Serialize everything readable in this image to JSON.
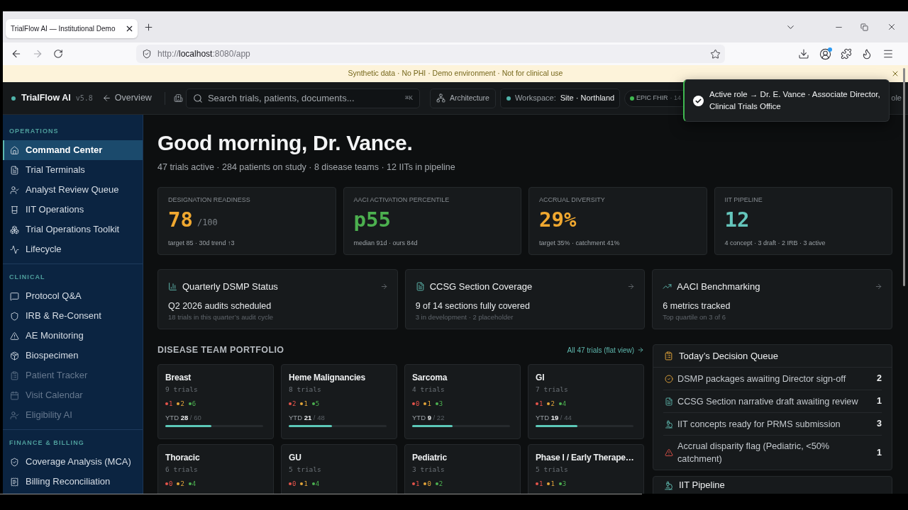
{
  "browser": {
    "tab_title": "TrialFlow AI — Institutional Demo",
    "url": {
      "scheme": "http://",
      "host": "localhost",
      "rest": ":8080/app"
    }
  },
  "banner": {
    "text": "Synthetic data · No PHI · Demo environment · Not for clinical use"
  },
  "header": {
    "brand": "TrialFlow AI",
    "version": "v5.8",
    "back_link": "Overview",
    "search": {
      "placeholder": "Search trials, patients, documents...",
      "shortcut": "⌘K"
    },
    "architecture": "Architecture",
    "workspace": {
      "label": "Workspace:",
      "value": "Site · Northland"
    },
    "integration": {
      "name": "EPIC FHIR",
      "detail": "· 14"
    },
    "role_fragment": "ole"
  },
  "toast": {
    "text": "Active role → Dr. E. Vance · Associate Director, Clinical Trials Office"
  },
  "sidebar": {
    "sections": [
      {
        "title": "OPERATIONS",
        "items": [
          {
            "label": "Command Center",
            "selected": true,
            "disabled": false
          },
          {
            "label": "Trial Terminals",
            "selected": false,
            "disabled": false
          },
          {
            "label": "Analyst Review Queue",
            "selected": false,
            "disabled": false
          },
          {
            "label": "IIT Operations",
            "selected": false,
            "disabled": false
          },
          {
            "label": "Trial Operations Toolkit",
            "selected": false,
            "disabled": false
          },
          {
            "label": "Lifecycle",
            "selected": false,
            "disabled": false
          }
        ]
      },
      {
        "title": "CLINICAL",
        "items": [
          {
            "label": "Protocol Q&A",
            "selected": false,
            "disabled": false
          },
          {
            "label": "IRB & Re-Consent",
            "selected": false,
            "disabled": false
          },
          {
            "label": "AE Monitoring",
            "selected": false,
            "disabled": false
          },
          {
            "label": "Biospecimen",
            "selected": false,
            "disabled": false
          },
          {
            "label": "Patient Tracker",
            "selected": false,
            "disabled": true
          },
          {
            "label": "Visit Calendar",
            "selected": false,
            "disabled": true
          },
          {
            "label": "Eligibility AI",
            "selected": false,
            "disabled": true
          }
        ]
      },
      {
        "title": "FINANCE & BILLING",
        "items": [
          {
            "label": "Coverage Analysis (MCA)",
            "selected": false,
            "disabled": false
          },
          {
            "label": "Billing Reconciliation",
            "selected": false,
            "disabled": false
          }
        ]
      }
    ]
  },
  "greeting": {
    "title": "Good morning, Dr. Vance.",
    "subtitle": "47 trials active · 284 patients on study · 8 disease teams · 12 IITs in pipeline"
  },
  "kpis": [
    {
      "label": "DESIGNATION READINESS",
      "value": "78",
      "unit": "/100",
      "note": "target 85 · 30d trend ↑3",
      "color": "#f0a830"
    },
    {
      "label": "AACI ACTIVATION PERCENTILE",
      "value": "p55",
      "note": "median 91d · ours 84d",
      "color": "#4cb04f"
    },
    {
      "label": "ACCRUAL DIVERSITY",
      "value": "29%",
      "note": "target 35% · catchment 41%",
      "color": "#f0a830"
    },
    {
      "label": "IIT PIPELINE",
      "value": "12",
      "note": "4 concept · 3 draft · 2 IRB · 3 active",
      "color": "#64c5bb"
    }
  ],
  "summary_cards": [
    {
      "title": "Quarterly DSMP Status",
      "headline": "Q2 2026 audits scheduled",
      "note": "18 trials in this quarter’s audit cycle"
    },
    {
      "title": "CCSG Section Coverage",
      "headline": "9 of 14 sections fully covered",
      "note": "3 in development · 2 placeholder"
    },
    {
      "title": "AACI Benchmarking",
      "headline": "6 metrics tracked",
      "note": "Top quartile on 3 of 6"
    }
  ],
  "portfolio": {
    "title": "DISEASE TEAM PORTFOLIO",
    "link": "All 47 trials (flat view)",
    "teams": [
      {
        "name": "Breast",
        "trials": "9 trials",
        "status_counts": [
          {
            "color": "#e5534b",
            "count": "1"
          },
          {
            "color": "#e3a53a",
            "count": "2"
          },
          {
            "color": "#4cb050",
            "count": "6"
          }
        ],
        "ytd": {
          "label": "YTD",
          "value": "28",
          "target": "/ 60"
        },
        "level": 0.47
      },
      {
        "name": "Heme Malignancies",
        "trials": "8 trials",
        "status_counts": [
          {
            "color": "#e5534b",
            "count": "2"
          },
          {
            "color": "#e3a53a",
            "count": "1"
          },
          {
            "color": "#4cb050",
            "count": "5"
          }
        ],
        "ytd": {
          "label": "YTD",
          "value": "21",
          "target": "/ 48"
        },
        "level": 0.44
      },
      {
        "name": "Sarcoma",
        "trials": "4 trials",
        "status_counts": [
          {
            "color": "#e5534b",
            "count": "0"
          },
          {
            "color": "#e3a53a",
            "count": "1"
          },
          {
            "color": "#4cb050",
            "count": "3"
          }
        ],
        "ytd": {
          "label": "YTD",
          "value": "9",
          "target": "/ 22"
        },
        "level": 0.41
      },
      {
        "name": "GI",
        "trials": "7 trials",
        "status_counts": [
          {
            "color": "#e5534b",
            "count": "1"
          },
          {
            "color": "#e3a53a",
            "count": "2"
          },
          {
            "color": "#4cb050",
            "count": "4"
          }
        ],
        "ytd": {
          "label": "YTD",
          "value": "19",
          "target": "/ 44"
        },
        "level": 0.43
      },
      {
        "name": "Thoracic",
        "trials": "6 trials",
        "status_counts": [
          {
            "color": "#e5534b",
            "count": "0"
          },
          {
            "color": "#e3a53a",
            "count": "2"
          },
          {
            "color": "#4cb050",
            "count": "4"
          }
        ]
      },
      {
        "name": "GU",
        "trials": "5 trials",
        "status_counts": [
          {
            "color": "#e5534b",
            "count": "0"
          },
          {
            "color": "#e3a53a",
            "count": "1"
          },
          {
            "color": "#4cb050",
            "count": "4"
          }
        ]
      },
      {
        "name": "Pediatric",
        "trials": "3 trials",
        "status_counts": [
          {
            "color": "#e5534b",
            "count": "1"
          },
          {
            "color": "#e3a53a",
            "count": "0"
          },
          {
            "color": "#4cb050",
            "count": "2"
          }
        ]
      },
      {
        "name": "Phase I / Early Therape…",
        "trials": "5 trials",
        "status_counts": [
          {
            "color": "#e5534b",
            "count": "1"
          },
          {
            "color": "#e3a53a",
            "count": "1"
          },
          {
            "color": "#4cb050",
            "count": "3"
          }
        ]
      }
    ]
  },
  "decision_queue": {
    "title": "Today’s Decision Queue",
    "items": [
      {
        "text": "DSMP packages awaiting Director sign-off",
        "count": "2"
      },
      {
        "text": "CCSG Section narrative draft awaiting review",
        "count": "1"
      },
      {
        "text": "IIT concepts ready for PRMS submission",
        "count": "3"
      },
      {
        "text": "Accrual disparity flag (Pediatric, <50% catchment)",
        "count": "1"
      }
    ]
  },
  "iit_pipeline": {
    "title": "IIT Pipeline"
  }
}
